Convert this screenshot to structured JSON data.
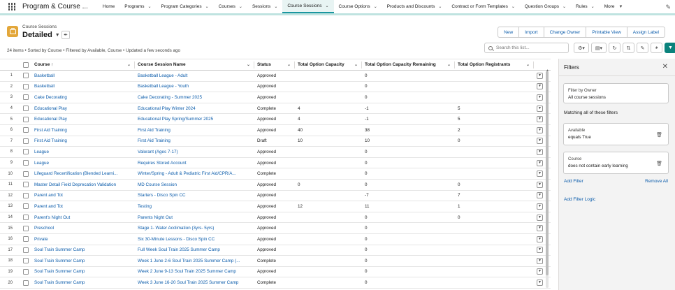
{
  "app": {
    "name": "Program & Course ...",
    "nav": [
      {
        "label": "Home",
        "chevron": false,
        "active": false
      },
      {
        "label": "Programs",
        "chevron": true,
        "active": false
      },
      {
        "label": "Program Categories",
        "chevron": true,
        "active": false
      },
      {
        "label": "Courses",
        "chevron": true,
        "active": false
      },
      {
        "label": "Sessions",
        "chevron": true,
        "active": false
      },
      {
        "label": "Course Sessions",
        "chevron": true,
        "active": true
      },
      {
        "label": "Course Options",
        "chevron": true,
        "active": false
      },
      {
        "label": "Products and Discounts",
        "chevron": true,
        "active": false
      },
      {
        "label": "Contract or Form Templates",
        "chevron": true,
        "active": false
      },
      {
        "label": "Question Groups",
        "chevron": true,
        "active": false
      },
      {
        "label": "Rules",
        "chevron": true,
        "active": false
      }
    ],
    "more_label": "More"
  },
  "header": {
    "object_label": "Course Sessions",
    "view_name": "Detailed",
    "buttons": [
      "New",
      "Import",
      "Change Owner",
      "Printable View",
      "Assign Label"
    ],
    "status": "24 items • Sorted by Course • Filtered by Available, Course • Updated a few seconds ago",
    "search_placeholder": "Search this list..."
  },
  "table": {
    "columns": [
      "Course ↑",
      "Course Session Name",
      "Status",
      "Total Option Capacity",
      "Total Option Capacity Remaining",
      "Total Option Registrants"
    ],
    "rows": [
      {
        "n": "1",
        "course": "Basketball",
        "session": "Basketball League - Adult",
        "status": "Approved",
        "cap": "",
        "rem": "0",
        "reg": ""
      },
      {
        "n": "2",
        "course": "Basketball",
        "session": "Basketball League - Youth",
        "status": "Approved",
        "cap": "",
        "rem": "0",
        "reg": ""
      },
      {
        "n": "3",
        "course": "Cake Decorating",
        "session": "Cake Decorating - Summer 2025",
        "status": "Approved",
        "cap": "",
        "rem": "0",
        "reg": ""
      },
      {
        "n": "4",
        "course": "Educational Play",
        "session": "Educational Play Winter 2024",
        "status": "Complete",
        "cap": "4",
        "rem": "-1",
        "reg": "5"
      },
      {
        "n": "5",
        "course": "Educational Play",
        "session": "Educational Play Spring/Summer 2025",
        "status": "Approved",
        "cap": "4",
        "rem": "-1",
        "reg": "5"
      },
      {
        "n": "6",
        "course": "First Aid Training",
        "session": "First Aid Training",
        "status": "Approved",
        "cap": "40",
        "rem": "38",
        "reg": "2"
      },
      {
        "n": "7",
        "course": "First Aid Training",
        "session": "First Aid Training",
        "status": "Draft",
        "cap": "10",
        "rem": "10",
        "reg": "0"
      },
      {
        "n": "8",
        "course": "League",
        "session": "Valorant (Ages 7-17)",
        "status": "Approved",
        "cap": "",
        "rem": "0",
        "reg": ""
      },
      {
        "n": "9",
        "course": "League",
        "session": "Requires Stored Account",
        "status": "Approved",
        "cap": "",
        "rem": "0",
        "reg": ""
      },
      {
        "n": "10",
        "course": "Lifeguard Recertification (Blended Learni...",
        "session": "Winter/Spring - Adult & Pediatric First Aid/CPR/A...",
        "status": "Complete",
        "cap": "",
        "rem": "0",
        "reg": ""
      },
      {
        "n": "11",
        "course": "Master Detail Field Deprecation Validation",
        "session": "MD Course Session",
        "status": "Approved",
        "cap": "0",
        "rem": "0",
        "reg": "0"
      },
      {
        "n": "12",
        "course": "Parent and Tot",
        "session": "Starters - Disco Spin CC",
        "status": "Approved",
        "cap": "",
        "rem": "-7",
        "reg": "7"
      },
      {
        "n": "13",
        "course": "Parent and Tot",
        "session": "Testing",
        "status": "Approved",
        "cap": "12",
        "rem": "11",
        "reg": "1"
      },
      {
        "n": "14",
        "course": "Parent's Night Out",
        "session": "Parents Night Out",
        "status": "Approved",
        "cap": "",
        "rem": "0",
        "reg": "0"
      },
      {
        "n": "15",
        "course": "Preschool",
        "session": "Stage 1- Water Acclimation (3yrs- 5yrs)",
        "status": "Approved",
        "cap": "",
        "rem": "0",
        "reg": ""
      },
      {
        "n": "16",
        "course": "Private",
        "session": "Six 30-Minute Lessons - Disco Spin CC",
        "status": "Approved",
        "cap": "",
        "rem": "0",
        "reg": ""
      },
      {
        "n": "17",
        "course": "Soul Train Summer Camp",
        "session": "Full Week Soul Train 2025 Summer Camp",
        "status": "Approved",
        "cap": "",
        "rem": "0",
        "reg": ""
      },
      {
        "n": "18",
        "course": "Soul Train Summer Camp",
        "session": "Week 1 June 2-6 Soul Train 2025 Summer Camp (...",
        "status": "Complete",
        "cap": "",
        "rem": "0",
        "reg": ""
      },
      {
        "n": "19",
        "course": "Soul Train Summer Camp",
        "session": "Week 2 June 9-13 Soul Train 2025 Summer Camp",
        "status": "Approved",
        "cap": "",
        "rem": "0",
        "reg": ""
      },
      {
        "n": "20",
        "course": "Soul Train Summer Camp",
        "session": "Week 3 June 16-20 Soul Train 2025 Summer Camp",
        "status": "Complete",
        "cap": "",
        "rem": "0",
        "reg": ""
      }
    ]
  },
  "filters": {
    "title": "Filters",
    "owner_label": "Filter by Owner",
    "owner_value": "All course sessions",
    "match_text": "Matching all of these filters",
    "items": [
      {
        "field": "Available",
        "condition": "equals True"
      },
      {
        "field": "Course",
        "condition": "does not contain early learning"
      }
    ],
    "add_filter": "Add Filter",
    "remove_all": "Remove All",
    "add_logic": "Add Filter Logic"
  },
  "colors": {
    "accent": "#0b827c",
    "link": "#0b5cab",
    "object_icon": "#e3a73a",
    "nav_underline": "#1b96a0"
  }
}
